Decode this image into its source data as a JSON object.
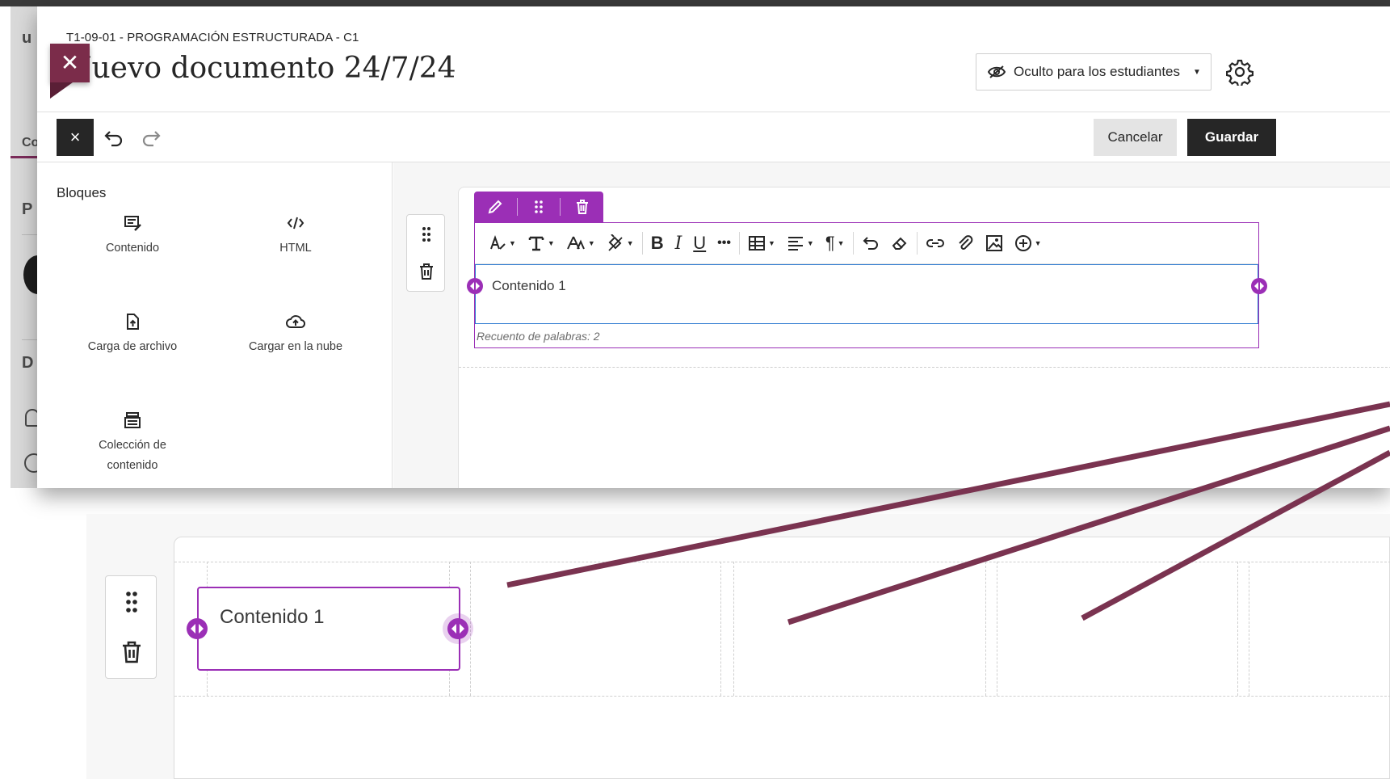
{
  "header": {
    "breadcrumb": "T1-09-01 - PROGRAMACIÓN ESTRUCTURADA - C1",
    "title": "Nuevo documento 24/7/24",
    "visibility_label": "Oculto para los estudiantes"
  },
  "toolbar": {
    "close_label": "×",
    "cancel_label": "Cancelar",
    "save_label": "Guardar"
  },
  "blocks_panel": {
    "title": "Bloques",
    "items": [
      {
        "label": "Contenido",
        "icon": "content-block-icon"
      },
      {
        "label": "HTML",
        "icon": "code-icon"
      },
      {
        "label": "Carga de archivo",
        "icon": "file-upload-icon"
      },
      {
        "label": "Cargar en la nube",
        "icon": "cloud-upload-icon"
      },
      {
        "label_line1": "Colección de",
        "label_line2": "contenido",
        "icon": "content-collection-icon"
      }
    ]
  },
  "editor": {
    "content_text": "Contenido 1",
    "word_count": "Recuento de palabras: 2",
    "rte_tools": [
      "text-style",
      "paragraph-format",
      "font-size",
      "highlight-color",
      "bold",
      "italic",
      "underline",
      "more",
      "table",
      "align",
      "paragraph",
      "undo",
      "clear-format",
      "link",
      "attachment",
      "image",
      "insert"
    ],
    "bold_glyph": "B",
    "italic_glyph": "I",
    "underline_glyph": "U",
    "more_glyph": "•••",
    "paragraph_glyph": "¶"
  },
  "zoom": {
    "block_text": "Contenido 1"
  },
  "colors": {
    "accent_purple": "#9b2fb6",
    "brand_maroon": "#7b2c4a",
    "annotation_line": "#7a3350",
    "dark_button": "#262626"
  }
}
